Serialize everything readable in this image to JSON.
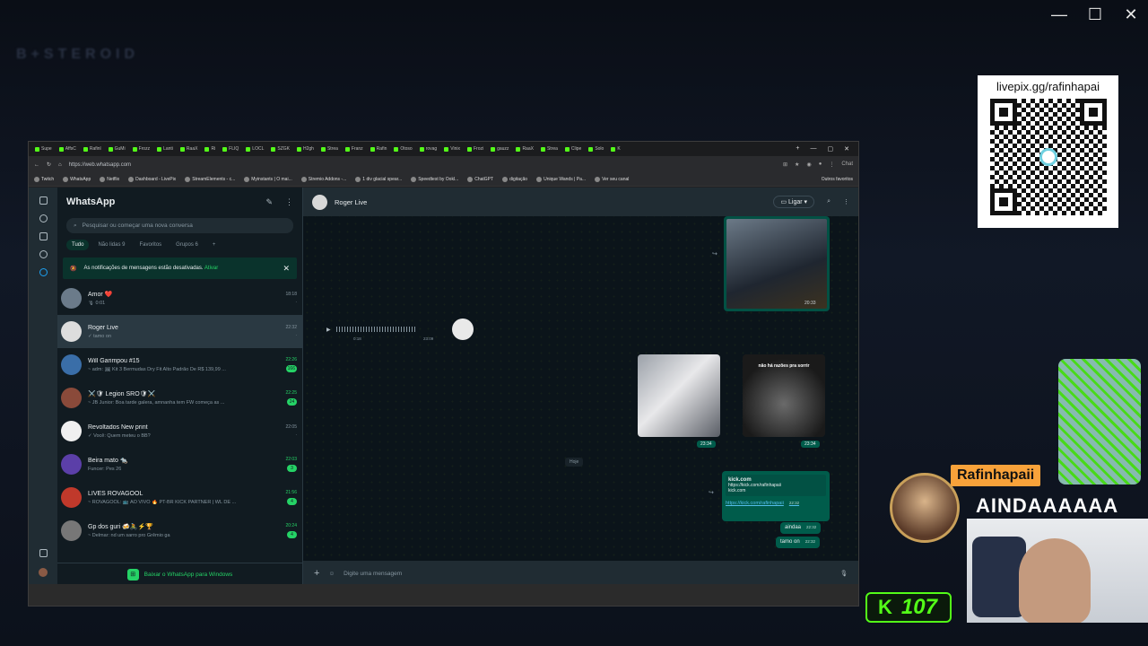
{
  "os": {
    "minimize": "—",
    "maximize": "☐",
    "close": "✕"
  },
  "browser": {
    "tabs": [
      "Supe",
      "AffsC",
      "Rafinl",
      "GuMi",
      "Frozz",
      "Lanti",
      "RaaX",
      "Ri",
      "FLIQ",
      "LOCL",
      "SZGK",
      "H2gh",
      "Strea",
      "Franz",
      "Rafin",
      "Otoso",
      "rovag",
      "Vinix",
      "Frozi",
      "gauzz",
      "RaaX",
      "Strea",
      "Clipe",
      "Solo",
      "K"
    ],
    "url": "https://web.whatsapp.com",
    "bookmarks": [
      "Twitch",
      "WhatsApp",
      "Netflix",
      "Dashboard - LivePix",
      "StreamElements - c...",
      "Myinstants | O mai...",
      "Stremio Addons -...",
      "1 div glacial spear...",
      "Speedtest by Ookl...",
      "ChatGPT",
      "digitação",
      "Unique Wands | Pa...",
      "Ver seu canal"
    ],
    "bookmarks_folder": "Outros favoritos",
    "chat_label": "Chat"
  },
  "sidebar": {
    "title": "WhatsApp",
    "search_placeholder": "Pesquisar ou começar uma nova conversa",
    "filters": [
      "Tudo",
      "Não lidas 9",
      "Favoritos",
      "Grupos 6"
    ],
    "notice": "As notificações de mensagens estão desativadas.",
    "notice_link": "Ativar",
    "chats": [
      {
        "name": "Amor ❤️",
        "preview": "🎙 0:01",
        "time": "18:18",
        "badge": "",
        "green": false
      },
      {
        "name": "Roger Live",
        "preview": "✓ tamo on",
        "time": "22:32",
        "badge": "",
        "green": false
      },
      {
        "name": "Will Garimpou #15",
        "preview": "~ adm: 🖼 Kit 3 Bermudas Dry Fit Alto Padrão De R$ 139,99 ...",
        "time": "22:26",
        "badge": "166",
        "green": true
      },
      {
        "name": "⚔️🛡 Legion SRO🛡⚔️",
        "preview": "~ JB Junior: Boa tarde galera, amnanha tem FW começa as ...",
        "time": "22:25",
        "badge": "24",
        "green": true
      },
      {
        "name": "Revoltados New print",
        "preview": "✓ Você: Quem meteu o BB?",
        "time": "22:05",
        "badge": "",
        "green": false
      },
      {
        "name": "Beira mato 🐀",
        "preview": "Funcer: Pes 26",
        "time": "22:03",
        "badge": "3",
        "green": true
      },
      {
        "name": "LIVES ROVAGOOL",
        "preview": "~ ROVAGOOL: 📺 AO VIVO 🔥 PT-BR KICK PARTNER | WL DE ...",
        "time": "21:56",
        "badge": "4",
        "green": true
      },
      {
        "name": "Gp dos guri 🍻🚴⚡🏆",
        "preview": "~ Delmar: nd um sarro pro Grêmio ga",
        "time": "20:24",
        "badge": "4",
        "green": true
      }
    ],
    "download": "Baixar o WhatsApp para Windows"
  },
  "conversation": {
    "contact": "Roger Live",
    "call_label": "Ligar",
    "img1_time": "20:33",
    "audio_duration": "0:18",
    "audio_time": "23:09",
    "img3_caption": "não há razões pra sorrir",
    "img2_time": "23:34",
    "img3_time": "23:34",
    "today": "Hoje",
    "link_title": "kick.com",
    "link_sub": "https://kick.com/rafinhapaii",
    "link_domain": "kick.com",
    "link_url": "https://kick.com/rafinhapaii",
    "link_time": "22:32",
    "msg2": "aindaa",
    "msg2_time": "22:32",
    "msg3": "tamo on",
    "msg3_time": "22:32",
    "compose_placeholder": "Digite uma mensagem"
  },
  "overlay": {
    "qr_label": "livepix.gg/rafinhapai",
    "streamer_name": "Rafinhapaii",
    "message": "AINDAAAAAA",
    "viewers": "107"
  }
}
